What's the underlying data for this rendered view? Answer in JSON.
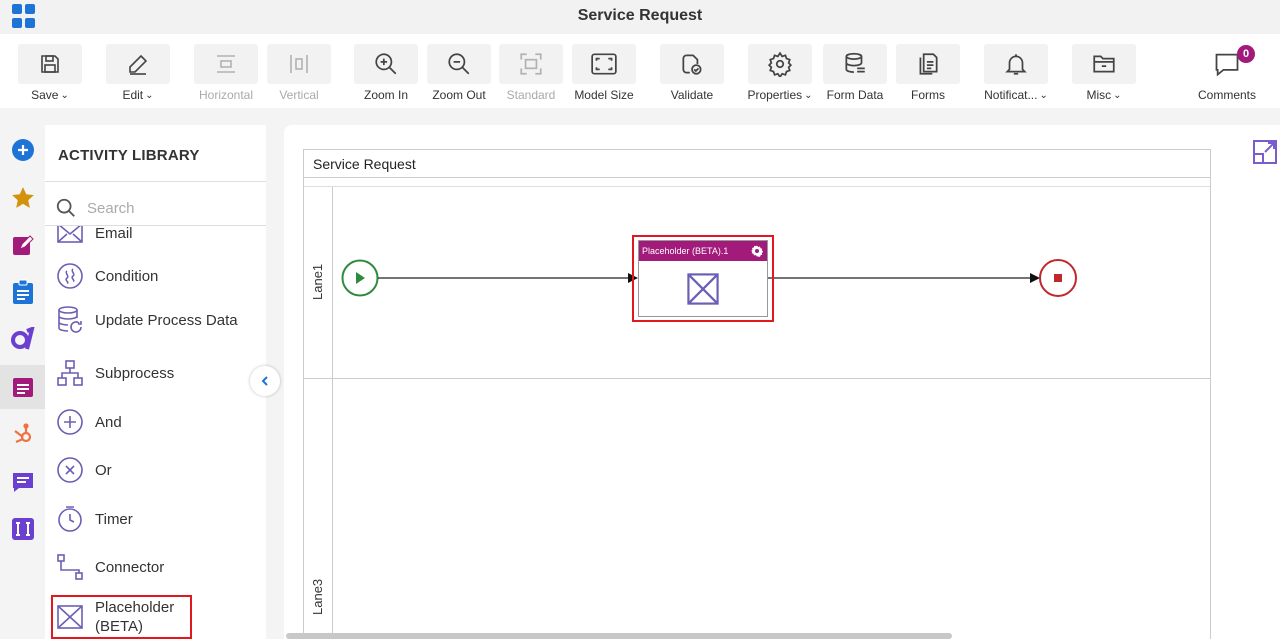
{
  "app": {
    "title": "Service Request"
  },
  "toolbar": {
    "buttons": [
      {
        "label": "Save",
        "icon": "save-icon",
        "dropdown": true,
        "enabled": true
      },
      {
        "label": "Edit",
        "icon": "pencil-icon",
        "dropdown": true,
        "enabled": true
      },
      {
        "label": "Horizontal",
        "icon": "horizontal-align-icon",
        "dropdown": false,
        "enabled": false
      },
      {
        "label": "Vertical",
        "icon": "vertical-align-icon",
        "dropdown": false,
        "enabled": false
      },
      {
        "label": "Zoom In",
        "icon": "zoom-in-icon",
        "dropdown": false,
        "enabled": true
      },
      {
        "label": "Zoom Out",
        "icon": "zoom-out-icon",
        "dropdown": false,
        "enabled": true
      },
      {
        "label": "Standard",
        "icon": "standard-size-icon",
        "dropdown": false,
        "enabled": false
      },
      {
        "label": "Model Size",
        "icon": "fit-to-screen-icon",
        "dropdown": false,
        "enabled": true
      },
      {
        "label": "Validate",
        "icon": "validate-icon",
        "dropdown": false,
        "enabled": true
      },
      {
        "label": "Properties",
        "icon": "gear-icon",
        "dropdown": true,
        "enabled": true
      },
      {
        "label": "Form Data",
        "icon": "database-icon",
        "dropdown": false,
        "enabled": true
      },
      {
        "label": "Forms",
        "icon": "forms-icon",
        "dropdown": false,
        "enabled": true
      },
      {
        "label": "Notificat...",
        "icon": "bell-icon",
        "dropdown": true,
        "enabled": true
      },
      {
        "label": "Misc",
        "icon": "folder-icon",
        "dropdown": true,
        "enabled": true
      }
    ],
    "comments": {
      "label": "Comments",
      "count": "0"
    }
  },
  "library": {
    "title": "ACTIVITY LIBRARY",
    "search_placeholder": "Search",
    "items": [
      {
        "label": "Email",
        "icon": "email-icon"
      },
      {
        "label": "Condition",
        "icon": "condition-icon"
      },
      {
        "label": "Update Process Data",
        "icon": "update-process-data-icon"
      },
      {
        "label": "Subprocess",
        "icon": "subprocess-icon"
      },
      {
        "label": "And",
        "icon": "and-gateway-icon"
      },
      {
        "label": "Or",
        "icon": "or-gateway-icon"
      },
      {
        "label": "Timer",
        "icon": "timer-icon"
      },
      {
        "label": "Connector",
        "icon": "connector-icon"
      },
      {
        "label": "Placeholder (BETA)",
        "icon": "placeholder-icon"
      }
    ]
  },
  "rail": {
    "items": [
      "add-icon",
      "star-icon",
      "edit-form-icon",
      "clipboard-icon",
      "agilepoint-icon",
      "document-icon",
      "hubspot-icon",
      "chat-icon",
      "integration-icon"
    ]
  },
  "canvas": {
    "pool_title": "Service Request",
    "lanes": [
      {
        "label": "Lane1"
      },
      {
        "label": "Lane3"
      }
    ],
    "task": {
      "title": "Placeholder (BETA).1"
    }
  },
  "colors": {
    "accent": "#a21a7a",
    "start": "#2e8b3e",
    "end": "#c0282d",
    "highlight": "#e0191e",
    "primary": "#1e74d6"
  }
}
